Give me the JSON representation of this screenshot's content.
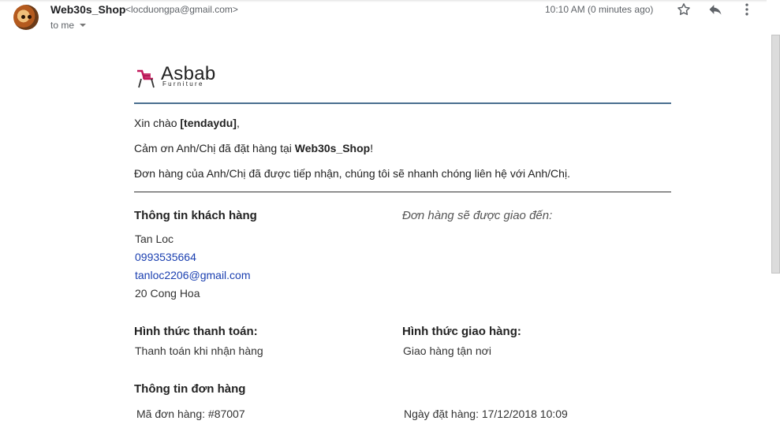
{
  "header": {
    "sender_name": "Web30s_Shop",
    "sender_email": "<locduongpa@gmail.com>",
    "recipient": "to me",
    "timestamp": "10:10 AM (0 minutes ago)",
    "icons": [
      "star-icon",
      "reply-icon",
      "more-vert-icon"
    ]
  },
  "logo": {
    "word": "Asbab",
    "sub": "Furniture",
    "icon": "chair-icon",
    "accent_color": "#c2185b"
  },
  "greeting": {
    "prefix": "Xin chào ",
    "name": "[tendaydu]",
    "suffix": ","
  },
  "thanks": {
    "prefix": "Cảm ơn Anh/Chị đã đặt hàng tại ",
    "shop": "Web30s_Shop",
    "suffix": "!"
  },
  "notice": "Đơn hàng của Anh/Chị đã được tiếp nhận, chúng tôi sẽ nhanh chóng liên hệ với Anh/Chị.",
  "customer": {
    "heading": "Thông tin khách hàng",
    "name": "Tan Loc",
    "phone": "0993535664",
    "email": "tanloc2206@gmail.com",
    "address": "20 Cong Hoa"
  },
  "delivery_to": {
    "heading": "Đơn hàng sẽ được giao đến:"
  },
  "payment": {
    "heading": "Hình thức thanh toán:",
    "value": "Thanh toán khi nhận hàng"
  },
  "shipping": {
    "heading": "Hình thức giao hàng:",
    "value": "Giao hàng tận nơi"
  },
  "order": {
    "heading": "Thông tin đơn hàng",
    "code": "Mã đơn hàng: #87007",
    "date": "Ngày đặt hàng: 17/12/2018 10:09"
  },
  "colors": {
    "link": "#1a3fb0",
    "divider": "#4a6f8f"
  }
}
